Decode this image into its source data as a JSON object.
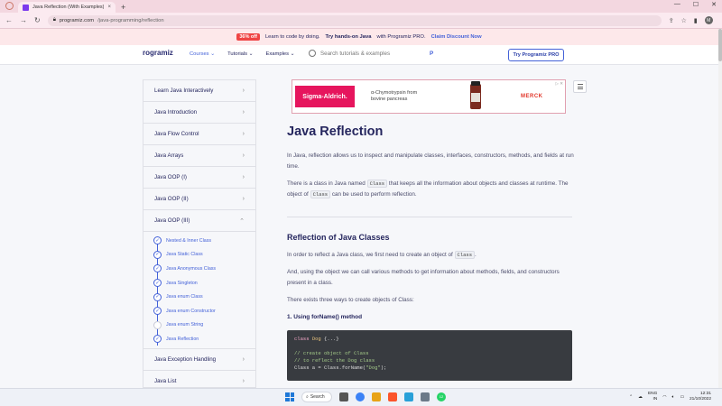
{
  "browser": {
    "tab_title": "Java Reflection (With Examples)",
    "tab_close": "×",
    "new_tab": "+",
    "url_host": "programiz.com",
    "url_path": "/java-programming/reflection",
    "profile_initial": "M",
    "window_controls": [
      "—",
      "☐",
      "✕"
    ]
  },
  "promo": {
    "badge": "36% off",
    "text_lead": "Learn to code by doing.",
    "text_bold": "Try hands-on Java",
    "text_tail": "with Programiz PRO.",
    "link": "Claim Discount Now"
  },
  "header": {
    "logo": "rogramiz",
    "logo_p": "P",
    "menu": [
      {
        "label": "Courses ⌄"
      },
      {
        "label": "Tutorials ⌄"
      },
      {
        "label": "Examples ⌄"
      }
    ],
    "search_placeholder": "Search tutorials & examples",
    "pro_button": "Try Programiz PRO"
  },
  "sidebar": {
    "items_top": [
      {
        "label": "Learn Java Interactively",
        "chev": "›"
      },
      {
        "label": "Java Introduction",
        "chev": "›"
      },
      {
        "label": "Java Flow Control",
        "chev": "›"
      },
      {
        "label": "Java Arrays",
        "chev": "›"
      },
      {
        "label": "Java OOP (I)",
        "chev": "›"
      },
      {
        "label": "Java OOP (II)",
        "chev": "›"
      },
      {
        "label": "Java OOP (III)",
        "chev": "⌃"
      }
    ],
    "subitems": [
      {
        "label": "Nested & Inner Class",
        "check": "✓"
      },
      {
        "label": "Java Static Class",
        "check": "✓"
      },
      {
        "label": "Java Anonymous Class",
        "check": "✓"
      },
      {
        "label": "Java Singleton",
        "check": "✓"
      },
      {
        "label": "Java enum Class",
        "check": "✓"
      },
      {
        "label": "Java enum Constructor",
        "check": "✓"
      },
      {
        "label": "Java enum String",
        "check": ""
      },
      {
        "label": "Java Reflection",
        "check": "✓"
      }
    ],
    "items_bottom": [
      {
        "label": "Java Exception Handling",
        "chev": "›"
      },
      {
        "label": "Java List",
        "chev": "›"
      }
    ]
  },
  "ad": {
    "brand": "Sigma-Aldrich.",
    "line1": "α-Chymotrypsin from",
    "line2": "bovine pancreas",
    "merck": "MERCK",
    "adchoice": "▷ ✕"
  },
  "article": {
    "title": "Java Reflection",
    "p1": "In Java, reflection allows us to inspect and manipulate classes, interfaces, constructors, methods, and fields at run time.",
    "p2a": "There is a class in Java named",
    "p2code": "Class",
    "p2b": "that keeps all the information about objects and classes at runtime. The object of",
    "p2code2": "Class",
    "p2c": "can be used to perform reflection.",
    "h2": "Reflection of Java Classes",
    "p3a": "In order to reflect a Java class, we first need to create an object of",
    "p3code": "Class",
    "p3b": ".",
    "p4": "And, using the object we can call various methods to get information about methods, fields, and constructors present in a class.",
    "p5": "There exists three ways to create objects of Class:",
    "h3": "1. Using forName() method",
    "code": {
      "l1kw": "class",
      "l1cls": "Dog",
      "l1rest": " {...}",
      "l2": "// create object of Class",
      "l3": "// to reflect the Dog class",
      "l4a": "Class a = Class.forName(",
      "l4str": "\"Dog\"",
      "l4b": ");"
    }
  },
  "taskbar": {
    "search": "Search",
    "lang1": "ENG",
    "lang2": "IN",
    "time": "12:31",
    "date": "21/10/2022",
    "badge": "12"
  }
}
